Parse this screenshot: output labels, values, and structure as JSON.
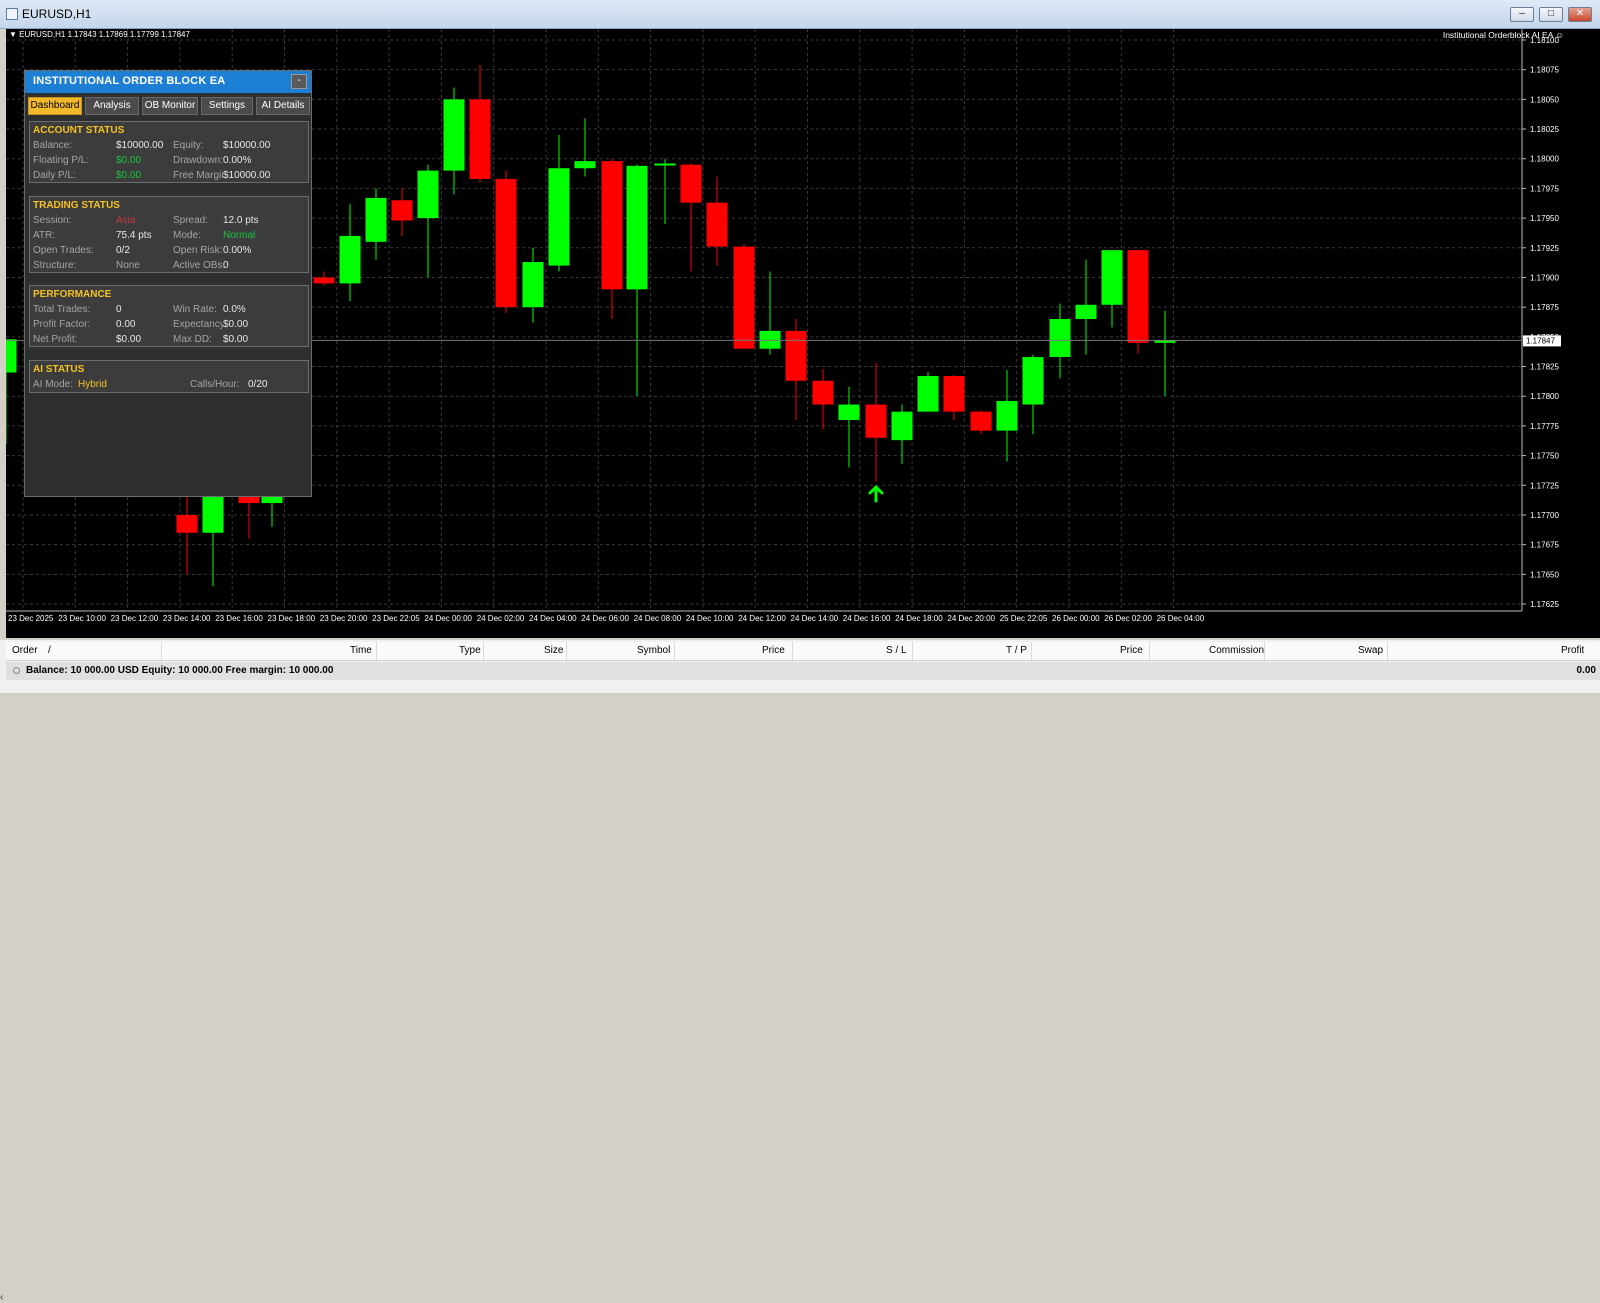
{
  "window": {
    "title": "EURUSD,H1",
    "buttons": [
      "minimize-button",
      "restore-button",
      "close-button"
    ]
  },
  "chart": {
    "header": "EURUSD,H1  1.17843 1.17869 1.17799 1.17847",
    "ea_label": "Institutional Orderblock AI EA",
    "current_price": "1.17847",
    "price_labels": [
      "1.18100",
      "1.18075",
      "1.18050",
      "1.18025",
      "1.18000",
      "1.17975",
      "1.17950",
      "1.17925",
      "1.17900",
      "1.17875",
      "1.17850",
      "1.17825",
      "1.17800",
      "1.17775",
      "1.17750",
      "1.17725",
      "1.17700",
      "1.17675",
      "1.17650",
      "1.17625"
    ],
    "time_labels": [
      "23 Dec 2025",
      "23 Dec 10:00",
      "23 Dec 12:00",
      "23 Dec 14:00",
      "23 Dec 16:00",
      "23 Dec 18:00",
      "23 Dec 20:00",
      "23 Dec 22:05",
      "24 Dec 00:00",
      "24 Dec 02:00",
      "24 Dec 04:00",
      "24 Dec 06:00",
      "24 Dec 08:00",
      "24 Dec 10:00",
      "24 Dec 12:00",
      "24 Dec 14:00",
      "24 Dec 16:00",
      "24 Dec 18:00",
      "24 Dec 20:00",
      "25 Dec 22:05",
      "26 Dec 00:00",
      "26 Dec 02:00",
      "26 Dec 04:00"
    ],
    "colors": {
      "bull": "#00ff00",
      "bear": "#ff0000",
      "background": "#000000",
      "grid": "#3a3a3a"
    }
  },
  "chart_data": {
    "type": "candlestick",
    "price_range": [
      1.17615,
      1.18115
    ],
    "candles": [
      {
        "o": 1.1782,
        "h": 1.17845,
        "l": 1.1776,
        "c": 1.17848
      },
      {
        "o": 1.177,
        "h": 1.1779,
        "l": 1.1765,
        "c": 1.17685
      },
      {
        "o": 1.17685,
        "h": 1.1776,
        "l": 1.1764,
        "c": 1.17725
      },
      {
        "o": 1.17725,
        "h": 1.1776,
        "l": 1.1768,
        "c": 1.1771
      },
      {
        "o": 1.1771,
        "h": 1.1774,
        "l": 1.1769,
        "c": 1.1772
      },
      {
        "o": 1.179,
        "h": 1.17905,
        "l": 1.17893,
        "c": 1.17895
      },
      {
        "o": 1.17895,
        "h": 1.17962,
        "l": 1.1788,
        "c": 1.17935
      },
      {
        "o": 1.1793,
        "h": 1.17975,
        "l": 1.17915,
        "c": 1.17967
      },
      {
        "o": 1.17965,
        "h": 1.17975,
        "l": 1.17935,
        "c": 1.17948
      },
      {
        "o": 1.1795,
        "h": 1.17995,
        "l": 1.179,
        "c": 1.1799
      },
      {
        "o": 1.1799,
        "h": 1.1806,
        "l": 1.1797,
        "c": 1.1805
      },
      {
        "o": 1.1805,
        "h": 1.18079,
        "l": 1.1798,
        "c": 1.17983
      },
      {
        "o": 1.17983,
        "h": 1.1799,
        "l": 1.1787,
        "c": 1.17875
      },
      {
        "o": 1.17875,
        "h": 1.17925,
        "l": 1.17862,
        "c": 1.17913
      },
      {
        "o": 1.1791,
        "h": 1.1802,
        "l": 1.17905,
        "c": 1.17992
      },
      {
        "o": 1.17992,
        "h": 1.18034,
        "l": 1.17985,
        "c": 1.17998
      },
      {
        "o": 1.17998,
        "h": 1.18,
        "l": 1.17865,
        "c": 1.1789
      },
      {
        "o": 1.1789,
        "h": 1.17995,
        "l": 1.178,
        "c": 1.17994
      },
      {
        "o": 1.17995,
        "h": 1.18,
        "l": 1.17945,
        "c": 1.17996
      },
      {
        "o": 1.17995,
        "h": 1.17996,
        "l": 1.17905,
        "c": 1.17963
      },
      {
        "o": 1.17963,
        "h": 1.17985,
        "l": 1.1791,
        "c": 1.17926
      },
      {
        "o": 1.17926,
        "h": 1.17928,
        "l": 1.1784,
        "c": 1.1784
      },
      {
        "o": 1.1784,
        "h": 1.17905,
        "l": 1.17835,
        "c": 1.17855
      },
      {
        "o": 1.17855,
        "h": 1.17865,
        "l": 1.1778,
        "c": 1.17813
      },
      {
        "o": 1.17813,
        "h": 1.17823,
        "l": 1.17772,
        "c": 1.17793
      },
      {
        "o": 1.1778,
        "h": 1.17808,
        "l": 1.1774,
        "c": 1.17793
      },
      {
        "o": 1.17793,
        "h": 1.17828,
        "l": 1.17728,
        "c": 1.17765
      },
      {
        "o": 1.17763,
        "h": 1.17793,
        "l": 1.17743,
        "c": 1.17787
      },
      {
        "o": 1.17787,
        "h": 1.1782,
        "l": 1.17787,
        "c": 1.17817
      },
      {
        "o": 1.17817,
        "h": 1.17818,
        "l": 1.1778,
        "c": 1.17787
      },
      {
        "o": 1.17787,
        "h": 1.17788,
        "l": 1.17768,
        "c": 1.17771
      },
      {
        "o": 1.17771,
        "h": 1.17822,
        "l": 1.17745,
        "c": 1.17796
      },
      {
        "o": 1.17793,
        "h": 1.17835,
        "l": 1.17768,
        "c": 1.17833
      },
      {
        "o": 1.17833,
        "h": 1.17878,
        "l": 1.17815,
        "c": 1.17865
      },
      {
        "o": 1.17865,
        "h": 1.17915,
        "l": 1.17835,
        "c": 1.17877
      },
      {
        "o": 1.17877,
        "h": 1.17913,
        "l": 1.17858,
        "c": 1.17923
      },
      {
        "o": 1.17923,
        "h": 1.17923,
        "l": 1.17836,
        "c": 1.17845
      },
      {
        "o": 1.17845,
        "h": 1.17872,
        "l": 1.178,
        "c": 1.17847
      }
    ]
  },
  "panel": {
    "title": "INSTITUTIONAL ORDER BLOCK EA",
    "minimize_label": "-",
    "tabs": [
      {
        "label": "Dashboard"
      },
      {
        "label": "Analysis"
      },
      {
        "label": "OB Monitor"
      },
      {
        "label": "Settings"
      },
      {
        "label": "AI Details"
      }
    ],
    "account": {
      "title": "ACCOUNT STATUS",
      "balance_label": "Balance:",
      "balance": "$10000.00",
      "equity_label": "Equity:",
      "equity": "$10000.00",
      "floating_label": "Floating P/L:",
      "floating": "$0.00",
      "drawdown_label": "Drawdown:",
      "drawdown": "0.00%",
      "daily_label": "Daily P/L:",
      "daily": "$0.00",
      "free_margin_label": "Free Margin:",
      "free_margin": "$10000.00"
    },
    "trading": {
      "title": "TRADING STATUS",
      "session_label": "Session:",
      "session": "Asia",
      "spread_label": "Spread:",
      "spread": "12.0 pts",
      "atr_label": "ATR:",
      "atr": "75.4 pts",
      "mode_label": "Mode:",
      "mode": "Normal",
      "open_trades_label": "Open Trades:",
      "open_trades": "0/2",
      "open_risk_label": "Open Risk:",
      "open_risk": "0.00%",
      "structure_label": "Structure:",
      "structure": "None",
      "active_obs_label": "Active OBs:",
      "active_obs": "0"
    },
    "performance": {
      "title": "PERFORMANCE",
      "total_trades_label": "Total Trades:",
      "total_trades": "0",
      "win_rate_label": "Win Rate:",
      "win_rate": "0.0%",
      "profit_factor_label": "Profit Factor:",
      "profit_factor": "0.00",
      "expectancy_label": "Expectancy:",
      "expectancy": "$0.00",
      "net_profit_label": "Net Profit:",
      "net_profit": "$0.00",
      "max_dd_label": "Max DD:",
      "max_dd": "$0.00"
    },
    "ai": {
      "title": "AI STATUS",
      "mode_label": "AI Mode:",
      "mode": "Hybrid",
      "calls_label": "Calls/Hour:",
      "calls": "0/20"
    }
  },
  "terminal": {
    "columns": [
      "Order",
      "/",
      "Time",
      "Type",
      "Size",
      "Symbol",
      "Price",
      "S / L",
      "T / P",
      "Price",
      "Commission",
      "Swap",
      "Profit"
    ],
    "balance_text": "Balance: 10 000.00 USD  Equity: 10 000.00  Free margin: 10 000.00",
    "profit": "0.00"
  }
}
